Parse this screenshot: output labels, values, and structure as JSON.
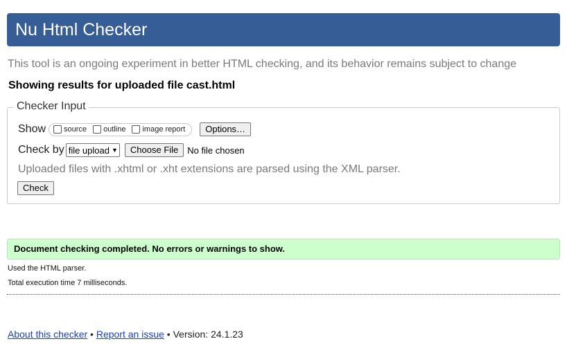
{
  "header": {
    "title": "Nu Html Checker",
    "bg_color": "#365d95"
  },
  "intro": "This tool is an ongoing experiment in better HTML checking, and its behavior remains subject to change",
  "results_heading": "Showing results for uploaded file cast.html",
  "checker_input": {
    "legend": "Checker Input",
    "show_label": "Show",
    "show_options": [
      {
        "label": "source",
        "checked": false
      },
      {
        "label": "outline",
        "checked": false
      },
      {
        "label": "image report",
        "checked": false
      }
    ],
    "options_button": "Options…",
    "check_by_label": "Check by",
    "check_by_value": "file upload",
    "choose_file_button": "Choose File",
    "no_file_text": "No file chosen",
    "hint": "Uploaded files with .xhtml or .xht extensions are parsed using the XML parser.",
    "check_button": "Check"
  },
  "status": {
    "message": "Document checking completed. No errors or warnings to show.",
    "bg_color": "#ccffcc"
  },
  "parser_info": "Used the HTML parser.",
  "execution_time": "Total execution time 7 milliseconds.",
  "footer": {
    "about_link": "About this checker",
    "separator1": " • ",
    "report_link": "Report an issue",
    "separator2": " • ",
    "version": "Version: 24.1.23"
  }
}
